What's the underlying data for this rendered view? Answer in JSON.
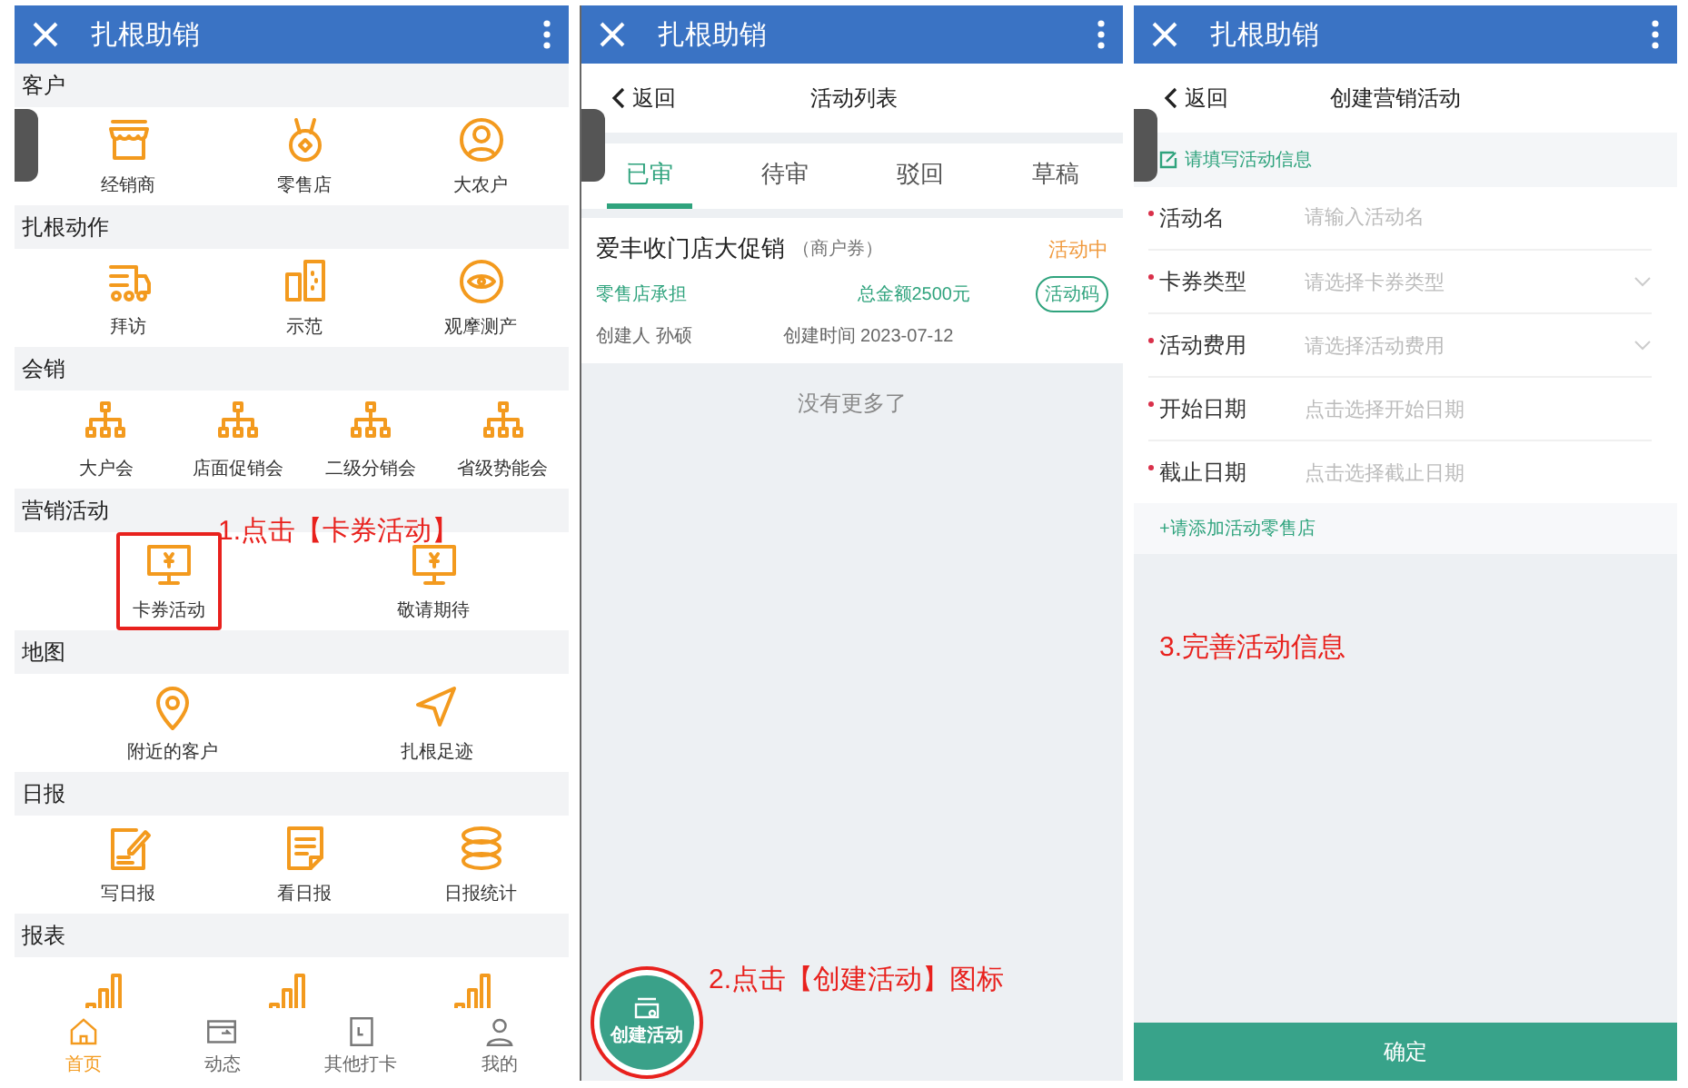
{
  "screens": [
    {
      "kind": "home",
      "title_bar": {
        "title": "扎根助销"
      },
      "sections": [
        {
          "title": "客户",
          "kind": "grid",
          "items": [
            {
              "label": "经销商",
              "highlighted": false
            },
            {
              "label": "零售店",
              "highlighted": false
            },
            {
              "label": "大农户",
              "highlighted": false
            }
          ]
        },
        {
          "title": "扎根动作",
          "kind": "grid",
          "items": [
            {
              "label": "拜访",
              "highlighted": false
            },
            {
              "label": "示范",
              "highlighted": false
            },
            {
              "label": "观摩测产",
              "highlighted": false
            }
          ]
        },
        {
          "title": "会销",
          "kind": "grid",
          "items": [
            {
              "label": "大户会",
              "highlighted": false
            },
            {
              "label": "店面促销会",
              "highlighted": false
            },
            {
              "label": "二级分销会",
              "highlighted": false
            },
            {
              "label": "省级势能会",
              "highlighted": false
            }
          ]
        },
        {
          "title": "营销活动",
          "kind": "grid",
          "items": [
            {
              "label": "卡券活动",
              "highlighted": true
            },
            {
              "label": "敬请期待",
              "highlighted": false
            }
          ]
        },
        {
          "title": "地图",
          "kind": "grid",
          "items": [
            {
              "label": "附近的客户",
              "highlighted": false
            },
            {
              "label": "扎根足迹",
              "highlighted": false
            }
          ]
        },
        {
          "title": "日报",
          "kind": "grid",
          "items": [
            {
              "label": "写日报",
              "highlighted": false
            },
            {
              "label": "看日报",
              "highlighted": false
            },
            {
              "label": "日报统计",
              "highlighted": false
            }
          ]
        },
        {
          "title": "报表",
          "kind": "partial"
        }
      ],
      "tab_bar": [
        {
          "label": "首页",
          "selected": true
        },
        {
          "label": "动态",
          "selected": false
        },
        {
          "label": "其他打卡",
          "selected": false
        },
        {
          "label": "我的",
          "selected": false
        }
      ],
      "annotation": "1.点击【卡券活动】"
    },
    {
      "kind": "list",
      "title_bar": {
        "title": "扎根助销"
      },
      "nav": {
        "back": "返回",
        "title": "活动列表"
      },
      "tabs": [
        {
          "label": "已审",
          "selected": true
        },
        {
          "label": "待审",
          "selected": false
        },
        {
          "label": "驳回",
          "selected": false
        },
        {
          "label": "草稿",
          "selected": false
        }
      ],
      "activities": [
        {
          "title": "爱丰收门店大促销",
          "type": "（商户券）",
          "status": "活动中",
          "bearer": "零售店承担",
          "total": "总金额2500元",
          "code_button": "活动码",
          "creator": "创建人 孙硕",
          "created": "创建时间 2023-07-12"
        }
      ],
      "end_note": "没有更多了",
      "fab": {
        "label": "创建活动"
      },
      "annotation": "2.点击【创建活动】图标"
    },
    {
      "kind": "form",
      "title_bar": {
        "title": "扎根助销"
      },
      "nav": {
        "back": "返回",
        "title": "创建营销活动"
      },
      "hint": "请填写活动信息",
      "fields": [
        {
          "label": "活动名",
          "required": true,
          "kind": "text",
          "placeholder": "请输入活动名"
        },
        {
          "label": "卡券类型",
          "required": true,
          "kind": "select",
          "placeholder": "请选择卡券类型"
        },
        {
          "label": "活动费用",
          "required": true,
          "kind": "select",
          "placeholder": "请选择活动费用"
        },
        {
          "label": "开始日期",
          "required": true,
          "kind": "date",
          "placeholder": "点击选择开始日期"
        },
        {
          "label": "截止日期",
          "required": true,
          "kind": "date",
          "placeholder": "点击选择截止日期"
        }
      ],
      "add_link": "+请添加活动零售店",
      "annotation": "3.完善活动信息",
      "submit": "确定"
    }
  ]
}
